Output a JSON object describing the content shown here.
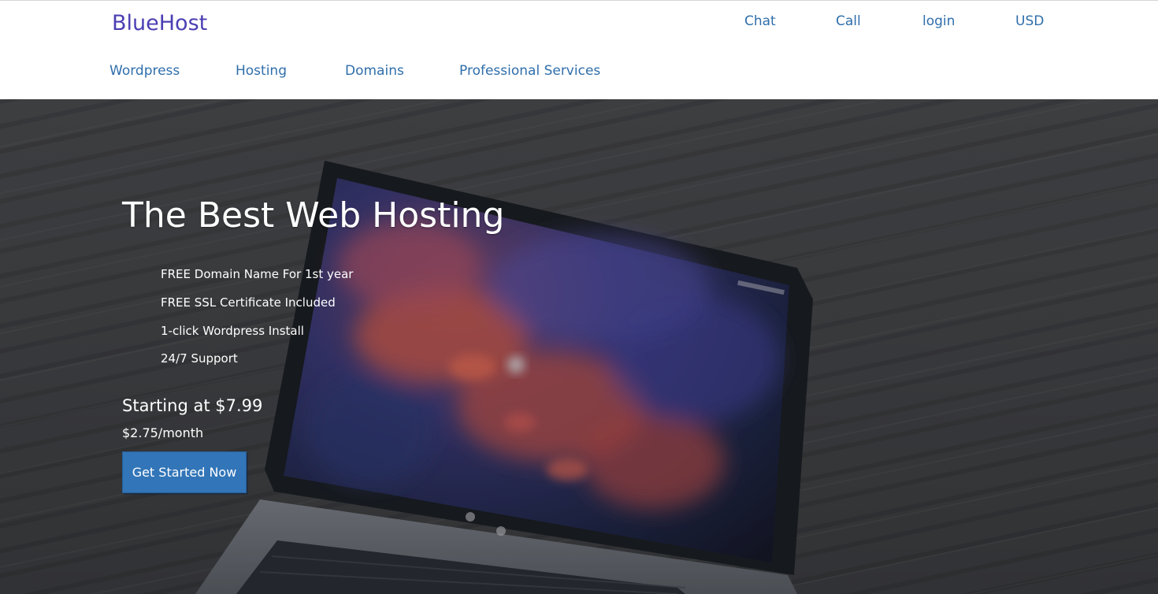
{
  "header": {
    "brand": "BlueHost",
    "utility_links": [
      "Chat",
      "Call",
      "login",
      "USD"
    ],
    "main_nav": [
      "Wordpress",
      "Hosting",
      "Domains",
      "Professional Services"
    ]
  },
  "hero": {
    "title": "The Best Web Hosting",
    "features": [
      "FREE Domain Name For 1st year",
      "FREE SSL Certificate Included",
      "1-click Wordpress Install",
      "24/7 Support"
    ],
    "starting_price": "Starting at $7.99",
    "monthly_price": "$2.75/month",
    "cta_label": "Get Started Now"
  },
  "colors": {
    "brand": "#4b3fb3",
    "link": "#2f6eab",
    "cta_background": "#3275b8",
    "hero_overlay": "#434548"
  }
}
